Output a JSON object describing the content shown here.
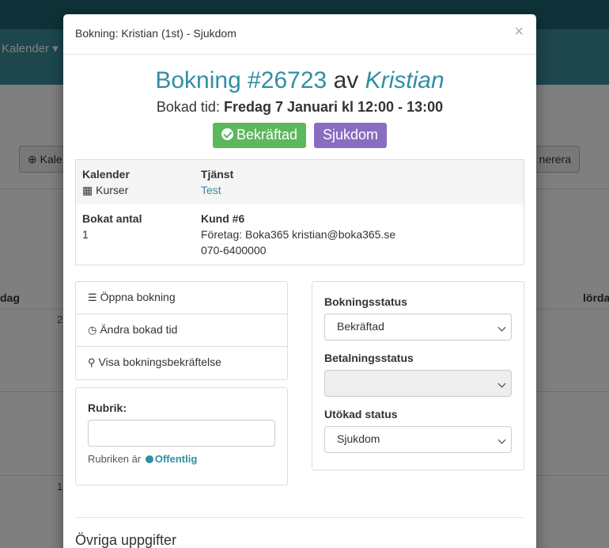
{
  "background": {
    "nav_kalender": "Kalender",
    "btn_left_label": "Kale",
    "btn_right_label": "nerera",
    "day_left": "dag",
    "day_right": "lörda",
    "num_1": "2",
    "num_2": "1"
  },
  "modal": {
    "title": "Bokning: Kristian (1st) - Sjukdom",
    "close_glyph": "×",
    "booking_number": "Bokning #26723",
    "av": "av",
    "customer": "Kristian",
    "booked_time_label": "Bokad tid:",
    "booked_time_value": "Fredag 7 Januari kl 12:00 - 13:00",
    "status_badge": "Bekräftad",
    "extended_badge": "Sjukdom",
    "colors": {
      "accent": "#2f8fa3",
      "confirmed": "#5cb85c",
      "extended": "#8a6cc1"
    }
  },
  "info": {
    "kalender_label": "Kalender",
    "kalender_value": "Kurser",
    "tjanst_label": "Tjänst",
    "tjanst_value": "Test",
    "bokat_antal_label": "Bokat antal",
    "bokat_antal_value": "1",
    "kund_label": "Kund #6",
    "kund_line1": "Företag: Boka365 kristian@boka365.se",
    "kund_line2": "070-6400000"
  },
  "actions": {
    "open": "Öppna bokning",
    "change_time": "Ändra bokad tid",
    "show_confirmation": "Visa bokningsbekräftelse"
  },
  "rubrik": {
    "label": "Rubrik:",
    "value": "",
    "note_prefix": "Rubriken är",
    "note_public": "Offentlig"
  },
  "status": {
    "booking_status_label": "Bokningsstatus",
    "booking_status_value": "Bekräftad",
    "payment_status_label": "Betalningsstatus",
    "payment_status_value": "",
    "extended_status_label": "Utökad status",
    "extended_status_value": "Sjukdom"
  },
  "other": {
    "heading": "Övriga uppgifter"
  }
}
